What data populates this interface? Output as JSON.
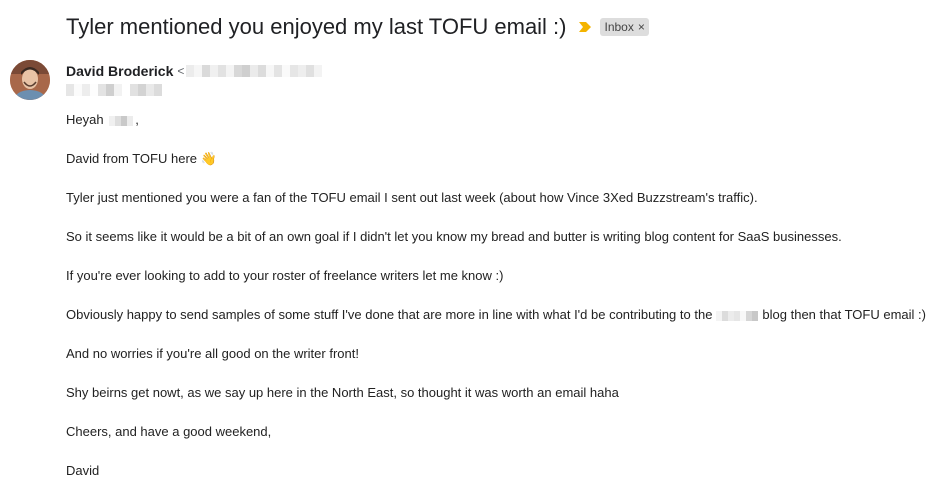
{
  "email": {
    "subject": "Tyler mentioned you enjoyed my last TOFU email :)",
    "label": "Inbox",
    "label_close": "×",
    "sender_name": "David Broderick",
    "sender_email_open": "<",
    "paragraphs": {
      "p1": "Heyah ",
      "p1_end": ",",
      "p2": "David from TOFU here 👋",
      "p3": "Tyler just mentioned you were a fan of the TOFU email I sent out last week (about how Vince 3Xed Buzzstream's traffic).",
      "p4": "So it seems like it would be a bit of an own goal if I didn't let you know my bread and butter is writing blog content for SaaS businesses.",
      "p5": "If you're ever looking to add to your roster of freelance writers let me know :)",
      "p6a": "Obviously happy to send samples of some stuff I've done that are more in line with what I'd be contributing to the",
      "p6b": "blog then that TOFU email :)",
      "p7": "And no worries if you're all good on the writer front!",
      "p8": "Shy beirns get nowt, as we say up here in the North East, so thought it was worth an email haha",
      "p9": "Cheers, and have a good weekend,",
      "p10": "David"
    }
  },
  "colors": {
    "importance_marker": "#f4b400",
    "label_chip_bg": "#dddddd"
  },
  "icons": {
    "importance": "importance-marker-icon",
    "avatar": "sender-avatar"
  }
}
